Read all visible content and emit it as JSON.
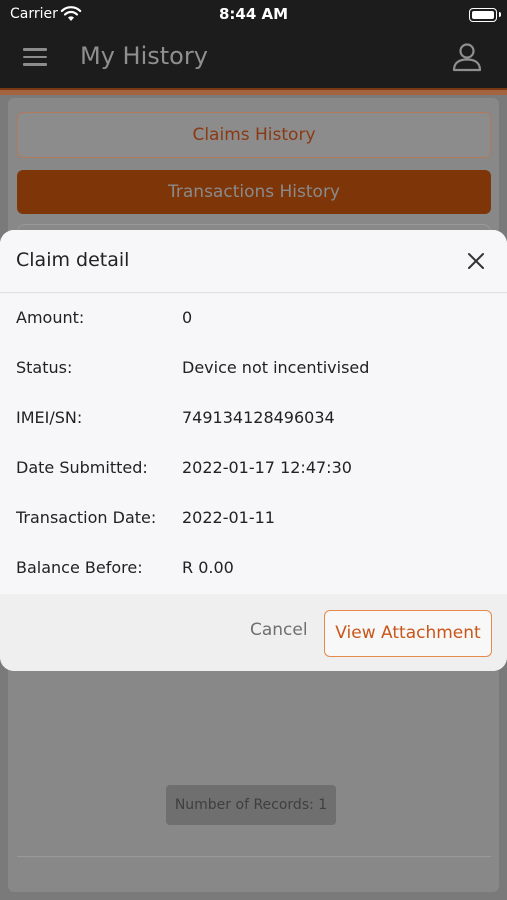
{
  "status_bar": {
    "carrier": "Carrier",
    "time": "8:44 AM"
  },
  "nav": {
    "title": "My History",
    "menu_icon": "menu-icon",
    "profile_icon": "person-icon"
  },
  "page": {
    "claims_history_label": "Claims History",
    "transactions_history_label": "Transactions History",
    "records_label": "Number of Records: 1"
  },
  "colors": {
    "accent": "#c8561a",
    "nav_bg": "#1c1c1c"
  },
  "dialog": {
    "title": "Claim detail",
    "fields": [
      {
        "label": "Amount:",
        "value": "0"
      },
      {
        "label": "Status:",
        "value": "Device not incentivised"
      },
      {
        "label": "IMEI/SN:",
        "value": "749134128496034"
      },
      {
        "label": "Date Submitted:",
        "value": "2022-01-17 12:47:30"
      },
      {
        "label": "Transaction Date:",
        "value": "2022-01-11"
      },
      {
        "label": "Balance Before:",
        "value": "R 0.00"
      }
    ],
    "cancel_label": "Cancel",
    "attachment_label": "View Attachment"
  }
}
